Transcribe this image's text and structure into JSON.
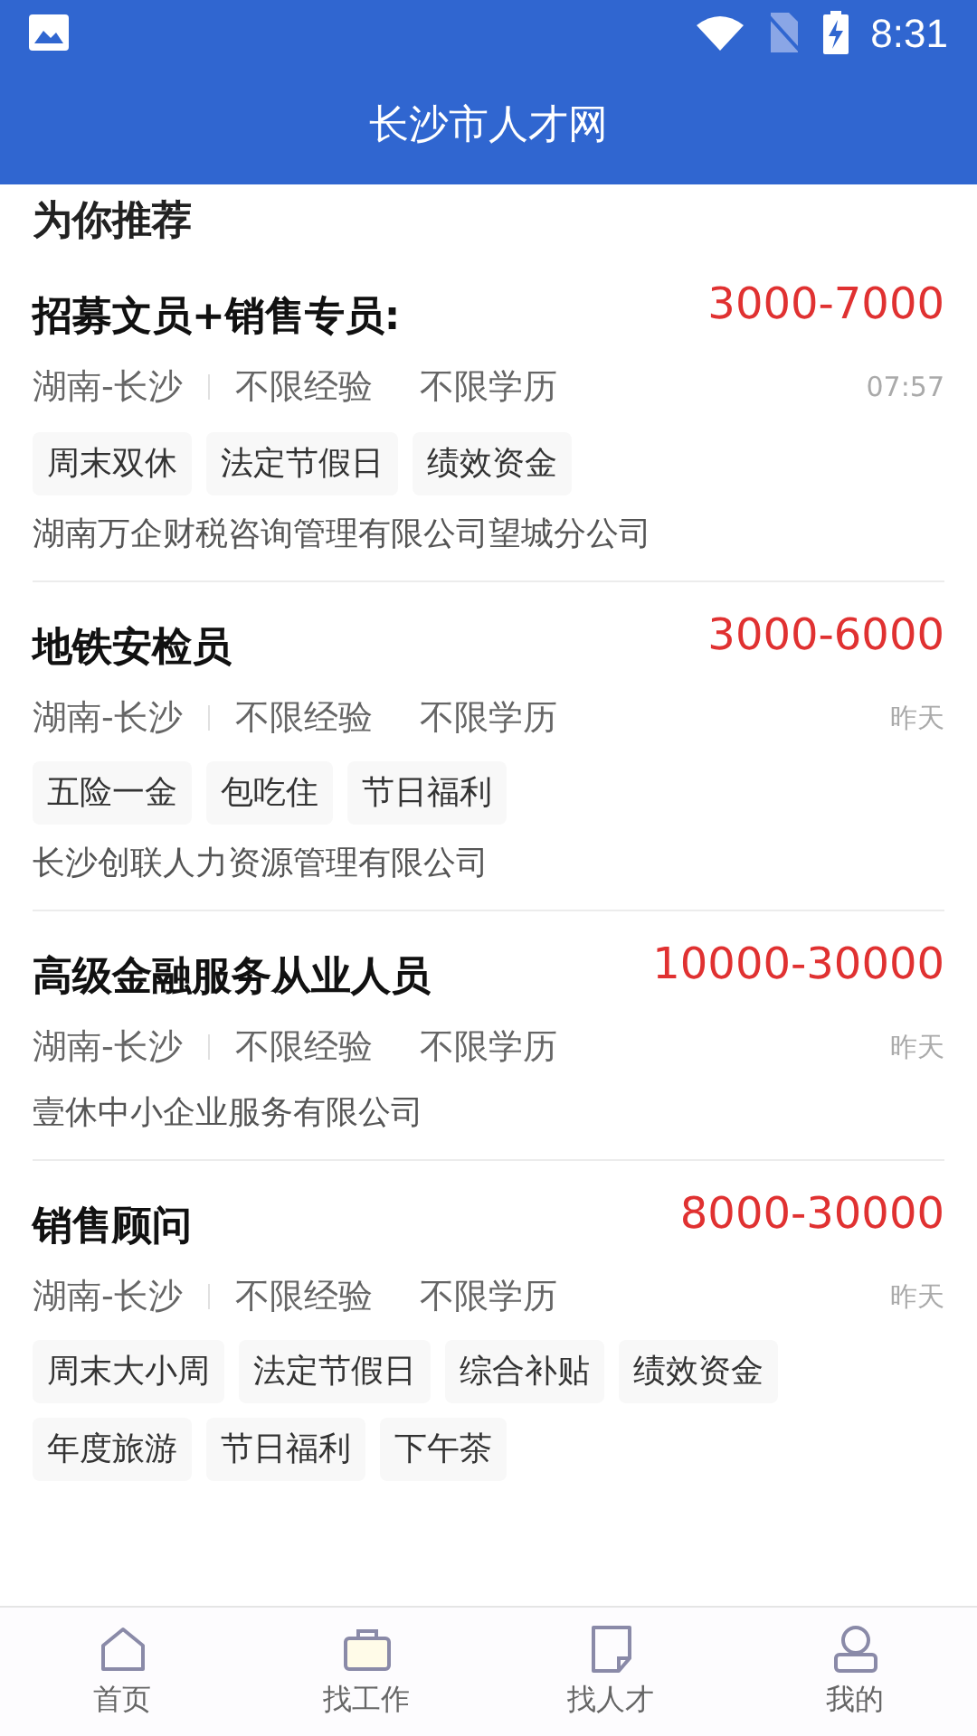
{
  "status_bar": {
    "time": "8:31"
  },
  "header": {
    "title": "长沙市人才网"
  },
  "section_title": "为你推荐",
  "jobs": [
    {
      "title": "招募文员+销售专员:",
      "salary": "3000-7000",
      "location": "湖南-长沙",
      "experience": "不限经验",
      "education": "不限学历",
      "time": "07:57",
      "tags": [
        "周末双休",
        "法定节假日",
        "绩效资金"
      ],
      "company": "湖南万企财税咨询管理有限公司望城分公司"
    },
    {
      "title": "地铁安检员",
      "salary": "3000-6000",
      "location": "湖南-长沙",
      "experience": "不限经验",
      "education": "不限学历",
      "time": "昨天",
      "tags": [
        "五险一金",
        "包吃住",
        "节日福利"
      ],
      "company": "长沙创联人力资源管理有限公司"
    },
    {
      "title": "高级金融服务从业人员",
      "salary": "10000-30000",
      "location": "湖南-长沙",
      "experience": "不限经验",
      "education": "不限学历",
      "time": "昨天",
      "company": "壹休中小企业服务有限公司"
    },
    {
      "title": "销售顾问",
      "salary": "8000-30000",
      "location": "湖南-长沙",
      "experience": "不限经验",
      "education": "不限学历",
      "time": "昨天",
      "tags": [
        "周末大小周",
        "法定节假日",
        "综合补贴",
        "绩效资金",
        "年度旅游",
        "节日福利",
        "下午茶"
      ]
    }
  ],
  "bottom_nav": [
    {
      "kind": "home",
      "label": "首页"
    },
    {
      "kind": "work",
      "label": "找工作"
    },
    {
      "kind": "talent",
      "label": "找人才"
    },
    {
      "kind": "me",
      "label": "我的"
    }
  ]
}
